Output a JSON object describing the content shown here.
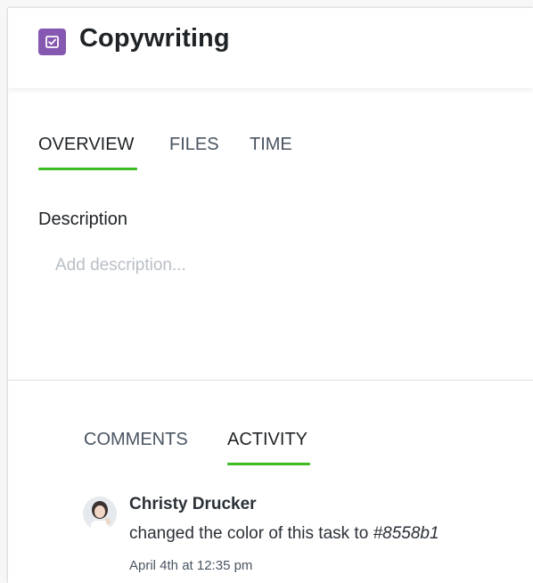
{
  "task": {
    "title": "Copywriting",
    "icon": "checkbox-icon",
    "icon_color": "#8558b1"
  },
  "tabs": [
    {
      "label": "OVERVIEW",
      "active": true
    },
    {
      "label": "FILES",
      "active": false
    },
    {
      "label": "TIME",
      "active": false
    }
  ],
  "description": {
    "label": "Description",
    "value": "",
    "placeholder": "Add description..."
  },
  "feed_tabs": [
    {
      "label": "COMMENTS",
      "active": false
    },
    {
      "label": "ACTIVITY",
      "active": true
    }
  ],
  "activity": [
    {
      "user": "Christy Drucker",
      "action": "changed the color of this task to",
      "color_value": "#8558b1",
      "time": "April 4th at 12:35 pm"
    }
  ],
  "colors": {
    "accent_underline": "#3cbc21",
    "tab_inactive": "#4a5562",
    "text_primary": "#1f2326"
  }
}
